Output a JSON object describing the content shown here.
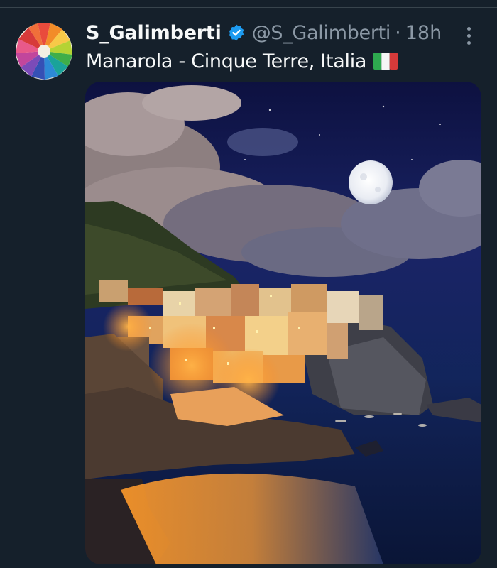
{
  "tweet": {
    "display_name": "S_Galimberti",
    "verified_icon": "verified-badge-icon",
    "handle": "@S_Galimberti",
    "separator": "·",
    "time": "18h",
    "more_icon": "more-options-icon",
    "text": "Manarola - Cinque Terre, Italia",
    "flag_icon": "italy-flag-icon",
    "media_icon": "photo-manarola-night"
  },
  "colors": {
    "background": "#15202b",
    "text_primary": "#f7f9f9",
    "text_secondary": "#8b98a5",
    "verified": "#1d9bf0"
  }
}
